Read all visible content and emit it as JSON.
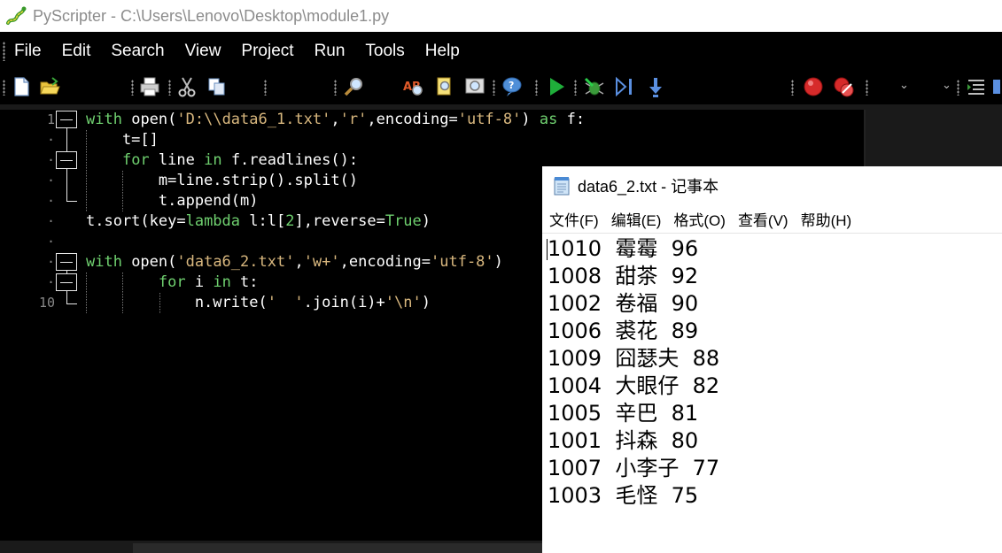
{
  "window": {
    "title": "PyScripter - C:\\Users\\Lenovo\\Desktop\\module1.py",
    "logo_icon": "pyscripter-snake-logo-icon"
  },
  "menu": [
    "File",
    "Edit",
    "Search",
    "View",
    "Project",
    "Run",
    "Tools",
    "Help"
  ],
  "toolbar": {
    "icons": [
      "new-file-icon",
      "open-file-icon",
      "print-icon",
      "cut-icon",
      "copy-icon",
      "find-icon",
      "spell-check-icon",
      "find-in-files-icon",
      "screen-capture-icon",
      "help-icon",
      "run-icon",
      "debug-icon",
      "step-into-icon",
      "step-over-icon",
      "breakpoint-icon",
      "clear-breakpoints-icon",
      "combo-arrow-icon",
      "combo-arrow-icon",
      "indent-icon",
      "outline-icon"
    ]
  },
  "editor": {
    "line_numbers": [
      "1",
      "·",
      "·",
      "·",
      "·",
      "·",
      "·",
      "·",
      "·",
      "10"
    ],
    "lines": [
      [
        [
          "kw",
          "with"
        ],
        [
          "p",
          " "
        ],
        [
          "p",
          "open("
        ],
        [
          "str",
          "'D:\\\\data6_1.txt'"
        ],
        [
          "p",
          ","
        ],
        [
          "str",
          "'r'"
        ],
        [
          "p",
          ",encoding="
        ],
        [
          "str",
          "'utf-8'"
        ],
        [
          "p",
          ") "
        ],
        [
          "kw",
          "as"
        ],
        [
          "p",
          " f:"
        ]
      ],
      [
        [
          "p",
          "    t=[]"
        ]
      ],
      [
        [
          "p",
          "    "
        ],
        [
          "kw",
          "for"
        ],
        [
          "p",
          " line "
        ],
        [
          "kw",
          "in"
        ],
        [
          "p",
          " f.readlines():"
        ]
      ],
      [
        [
          "p",
          "        m=line.strip().split()"
        ]
      ],
      [
        [
          "p",
          "        t.append(m)"
        ]
      ],
      [
        [
          "p",
          "t.sort(key="
        ],
        [
          "kw",
          "lambda"
        ],
        [
          "p",
          " l:l["
        ],
        [
          "num",
          "2"
        ],
        [
          "p",
          "],reverse="
        ],
        [
          "kw",
          "True"
        ],
        [
          "p",
          ")"
        ]
      ],
      [
        [
          "p",
          ""
        ]
      ],
      [
        [
          "kw",
          "with"
        ],
        [
          "p",
          " open("
        ],
        [
          "str",
          "'data6_2.txt'"
        ],
        [
          "p",
          ","
        ],
        [
          "str",
          "'w+'"
        ],
        [
          "p",
          ",encoding="
        ],
        [
          "str",
          "'utf-8'"
        ],
        [
          "p",
          ")"
        ]
      ],
      [
        [
          "p",
          "        "
        ],
        [
          "kw",
          "for"
        ],
        [
          "p",
          " i "
        ],
        [
          "kw",
          "in"
        ],
        [
          "p",
          " t:"
        ]
      ],
      [
        [
          "p",
          "            n.write("
        ],
        [
          "str",
          "'  '"
        ],
        [
          "p",
          ".join(i)+"
        ],
        [
          "str",
          "'\\n'"
        ],
        [
          "p",
          ")"
        ]
      ]
    ],
    "colors": {
      "keyword": "#6fd06f",
      "string": "#d8b77e",
      "plain": "#ffffff",
      "background": "#000000"
    }
  },
  "notepad": {
    "title": "data6_2.txt - 记事本",
    "icon": "notepad-icon",
    "menu": [
      "文件(F)",
      "编辑(E)",
      "格式(O)",
      "查看(V)",
      "帮助(H)"
    ],
    "lines": [
      "1010  霉霉  96",
      "1008  甜茶  92",
      "1002  卷福  90",
      "1006  裘花  89",
      "1009  囧瑟夫  88",
      "1004  大眼仔  82",
      "1005  辛巴  81",
      "1001  抖森  80",
      "1007  小李子  77",
      "1003  毛怪  75"
    ]
  }
}
